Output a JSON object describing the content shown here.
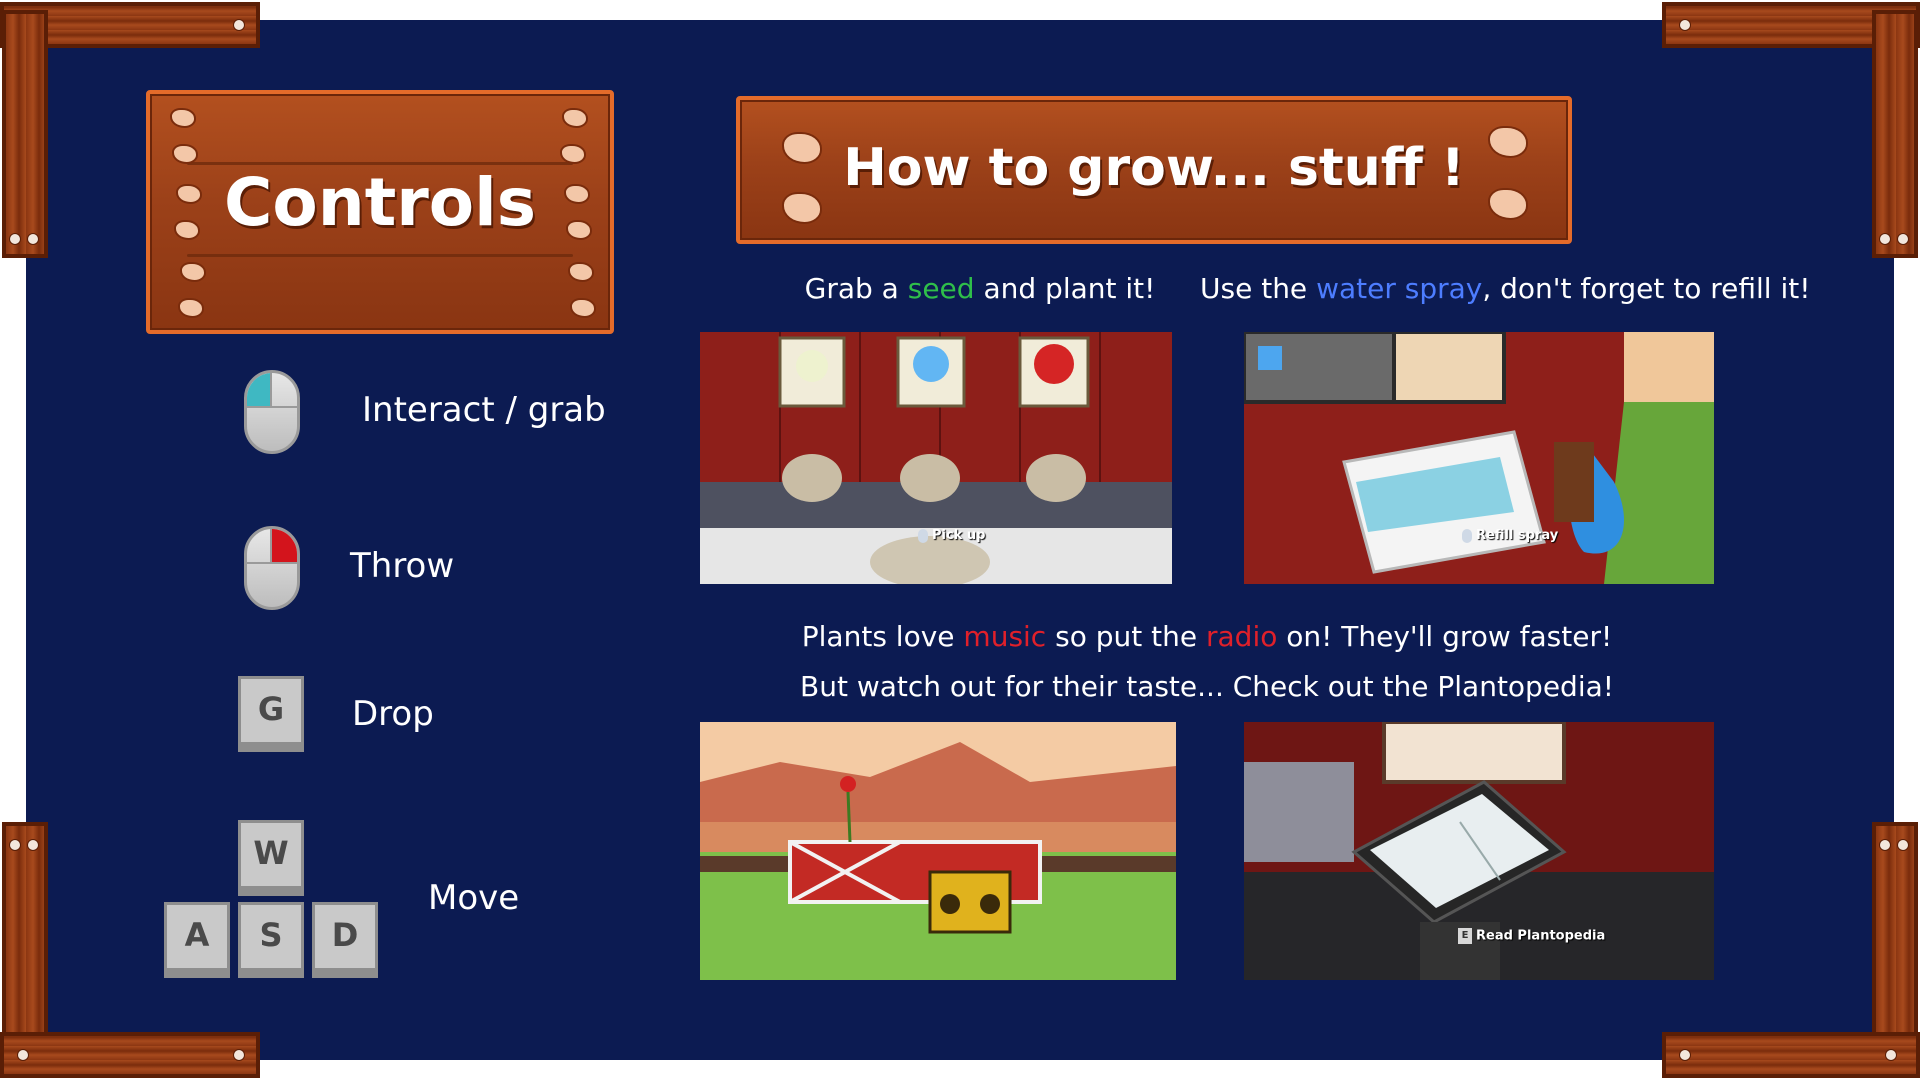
{
  "controls_sign": {
    "title": "Controls"
  },
  "controls": [
    {
      "icon": "mouse-left-click-icon",
      "label": "Interact / grab"
    },
    {
      "icon": "mouse-right-click-icon",
      "label": "Throw"
    },
    {
      "icon": "g-key-icon",
      "key": "G",
      "label": "Drop"
    },
    {
      "icon": "wasd-keys-icon",
      "keys": [
        "W",
        "A",
        "S",
        "D"
      ],
      "label": "Move"
    }
  ],
  "guide_sign": {
    "title": "How to grow... stuff !"
  },
  "tips": {
    "seed": {
      "pre": "Grab a ",
      "highlight": "seed",
      "post": " and plant it!"
    },
    "water": {
      "pre": "Use the ",
      "highlight": "water spray",
      "post": ", don't forget to refill it!"
    },
    "music_line1": {
      "pre": "Plants love ",
      "highlight1": "music",
      "mid": " so put the ",
      "highlight2": "radio",
      "post": " on!  They'll grow faster!"
    },
    "music_line2": "But watch out for their taste... Check out the Plantopedia!"
  },
  "screenshots": {
    "seed": {
      "prompt": "Pick up"
    },
    "water": {
      "prompt": "Refill spray"
    },
    "radio": {},
    "plantopedia": {
      "prompt_key": "E",
      "prompt": "Read Plantopedia"
    }
  },
  "colors": {
    "background_panel": "#0c1b52",
    "wood": "#a84a1d",
    "wood_border": "#e46b2a",
    "seed_highlight": "#2fbf4a",
    "water_highlight": "#4d7dff",
    "music_highlight": "#e0202a",
    "mouse_left": "#3fb8c2",
    "mouse_right": "#d3141c"
  }
}
